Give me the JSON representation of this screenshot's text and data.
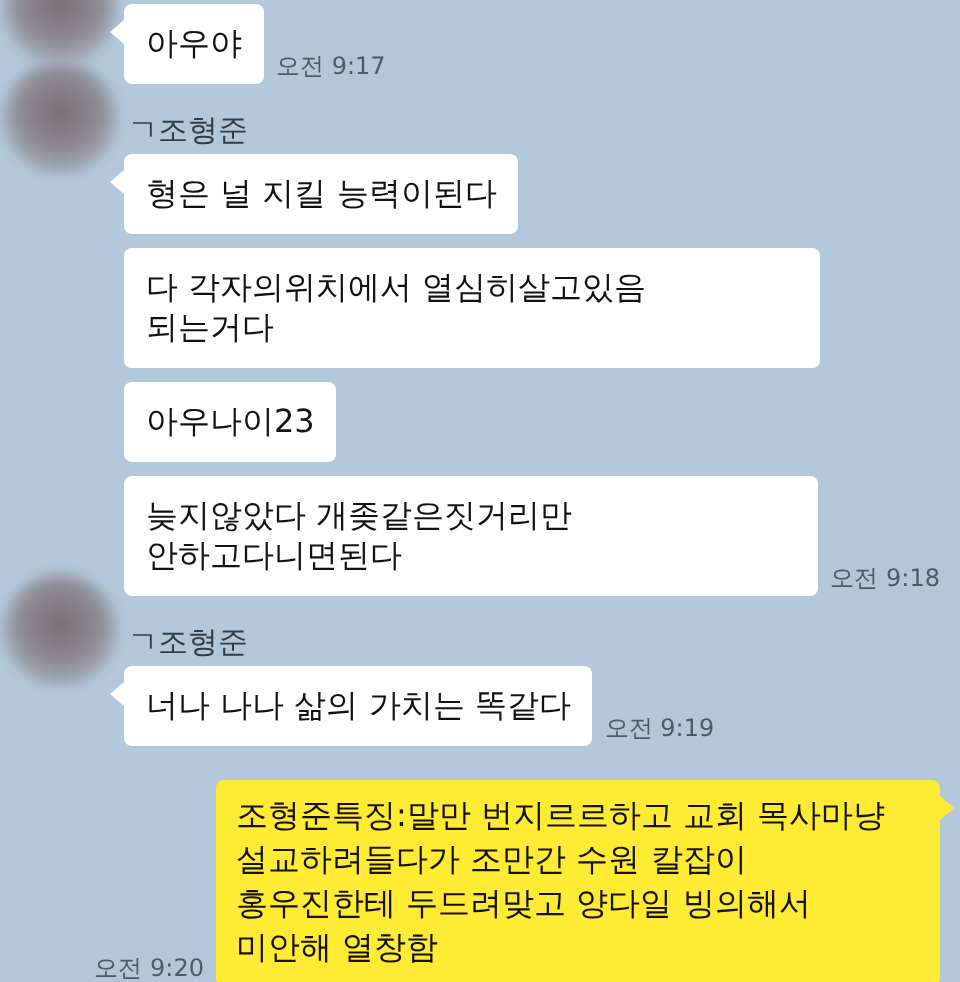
{
  "chat": [
    {
      "outgoing": false,
      "messages": [
        {
          "text": "아우야",
          "time": "오전 9:17"
        }
      ]
    },
    {
      "outgoing": false,
      "sender": "ㄱ조형준",
      "messages": [
        {
          "text": "형은 널 지킬 능력이된다"
        },
        {
          "text": "다 각자의위치에서 열심히살고있음\n되는거다"
        },
        {
          "text": "아우나이23"
        },
        {
          "text": "늦지않았다 개좆같은짓거리만\n안하고다니면된다",
          "time": "오전 9:18"
        }
      ]
    },
    {
      "outgoing": false,
      "sender": "ㄱ조형준",
      "messages": [
        {
          "text": "너나 나나 삶의 가치는 똑같다",
          "time": "오전 9:19"
        }
      ]
    },
    {
      "outgoing": true,
      "messages": [
        {
          "text": "조형준특징:말만 번지르르하고 교회 목사마냥\n설교하려들다가 조만간 수원 칼잡이\n홍우진한테 두드려맞고 양다일 빙의해서\n미안해 열창함",
          "time": "오전 9:20"
        }
      ]
    }
  ]
}
